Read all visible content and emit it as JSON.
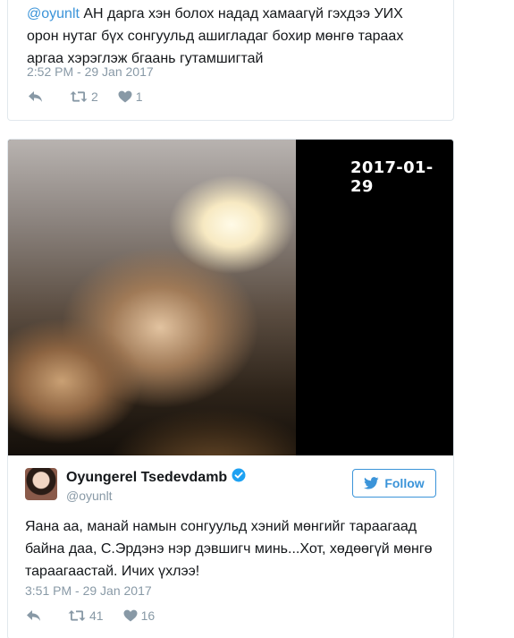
{
  "tweet_prev": {
    "mention": "@oyunlt",
    "text": " АН дарга хэн болох надад хамаагүй гэхдээ УИХ орон нутаг бүх сонгуульд ашигладаг бохир мөнгө тараах аргаа хэрэглэж бгаань гутамшигтай",
    "timestamp": "2:52 PM - 29 Jan 2017",
    "actions": {
      "reply_icon": "reply-icon",
      "retweet_icon": "retweet-icon",
      "retweet_count": "2",
      "like_icon": "heart-icon",
      "like_count": "1"
    }
  },
  "tweet_main": {
    "media": {
      "date_overlay": "2017-01-29"
    },
    "author": {
      "name": "Oyungerel Tsedevdamb",
      "handle": "@oyunlt",
      "verified": true
    },
    "follow_button": {
      "label": "Follow",
      "icon": "twitter-bird-icon"
    },
    "text": "Яана аа, манай намын сонгуульд хэний мөнгийг тараагаад байна даа, С.Эрдэнэ нэр дэвшигч минь...Хот, хөдөөгүй мөнгө тараагаастай. Ичих үхлээ!",
    "timestamp": "3:51 PM - 29 Jan 2017",
    "actions": {
      "reply_icon": "reply-icon",
      "retweet_icon": "retweet-icon",
      "retweet_count": "41",
      "like_icon": "heart-icon",
      "like_count": "16"
    }
  },
  "colors": {
    "link": "#3b94d9",
    "muted": "#8899a6",
    "border": "#e1e8ed",
    "verified": "#1da1f2"
  }
}
